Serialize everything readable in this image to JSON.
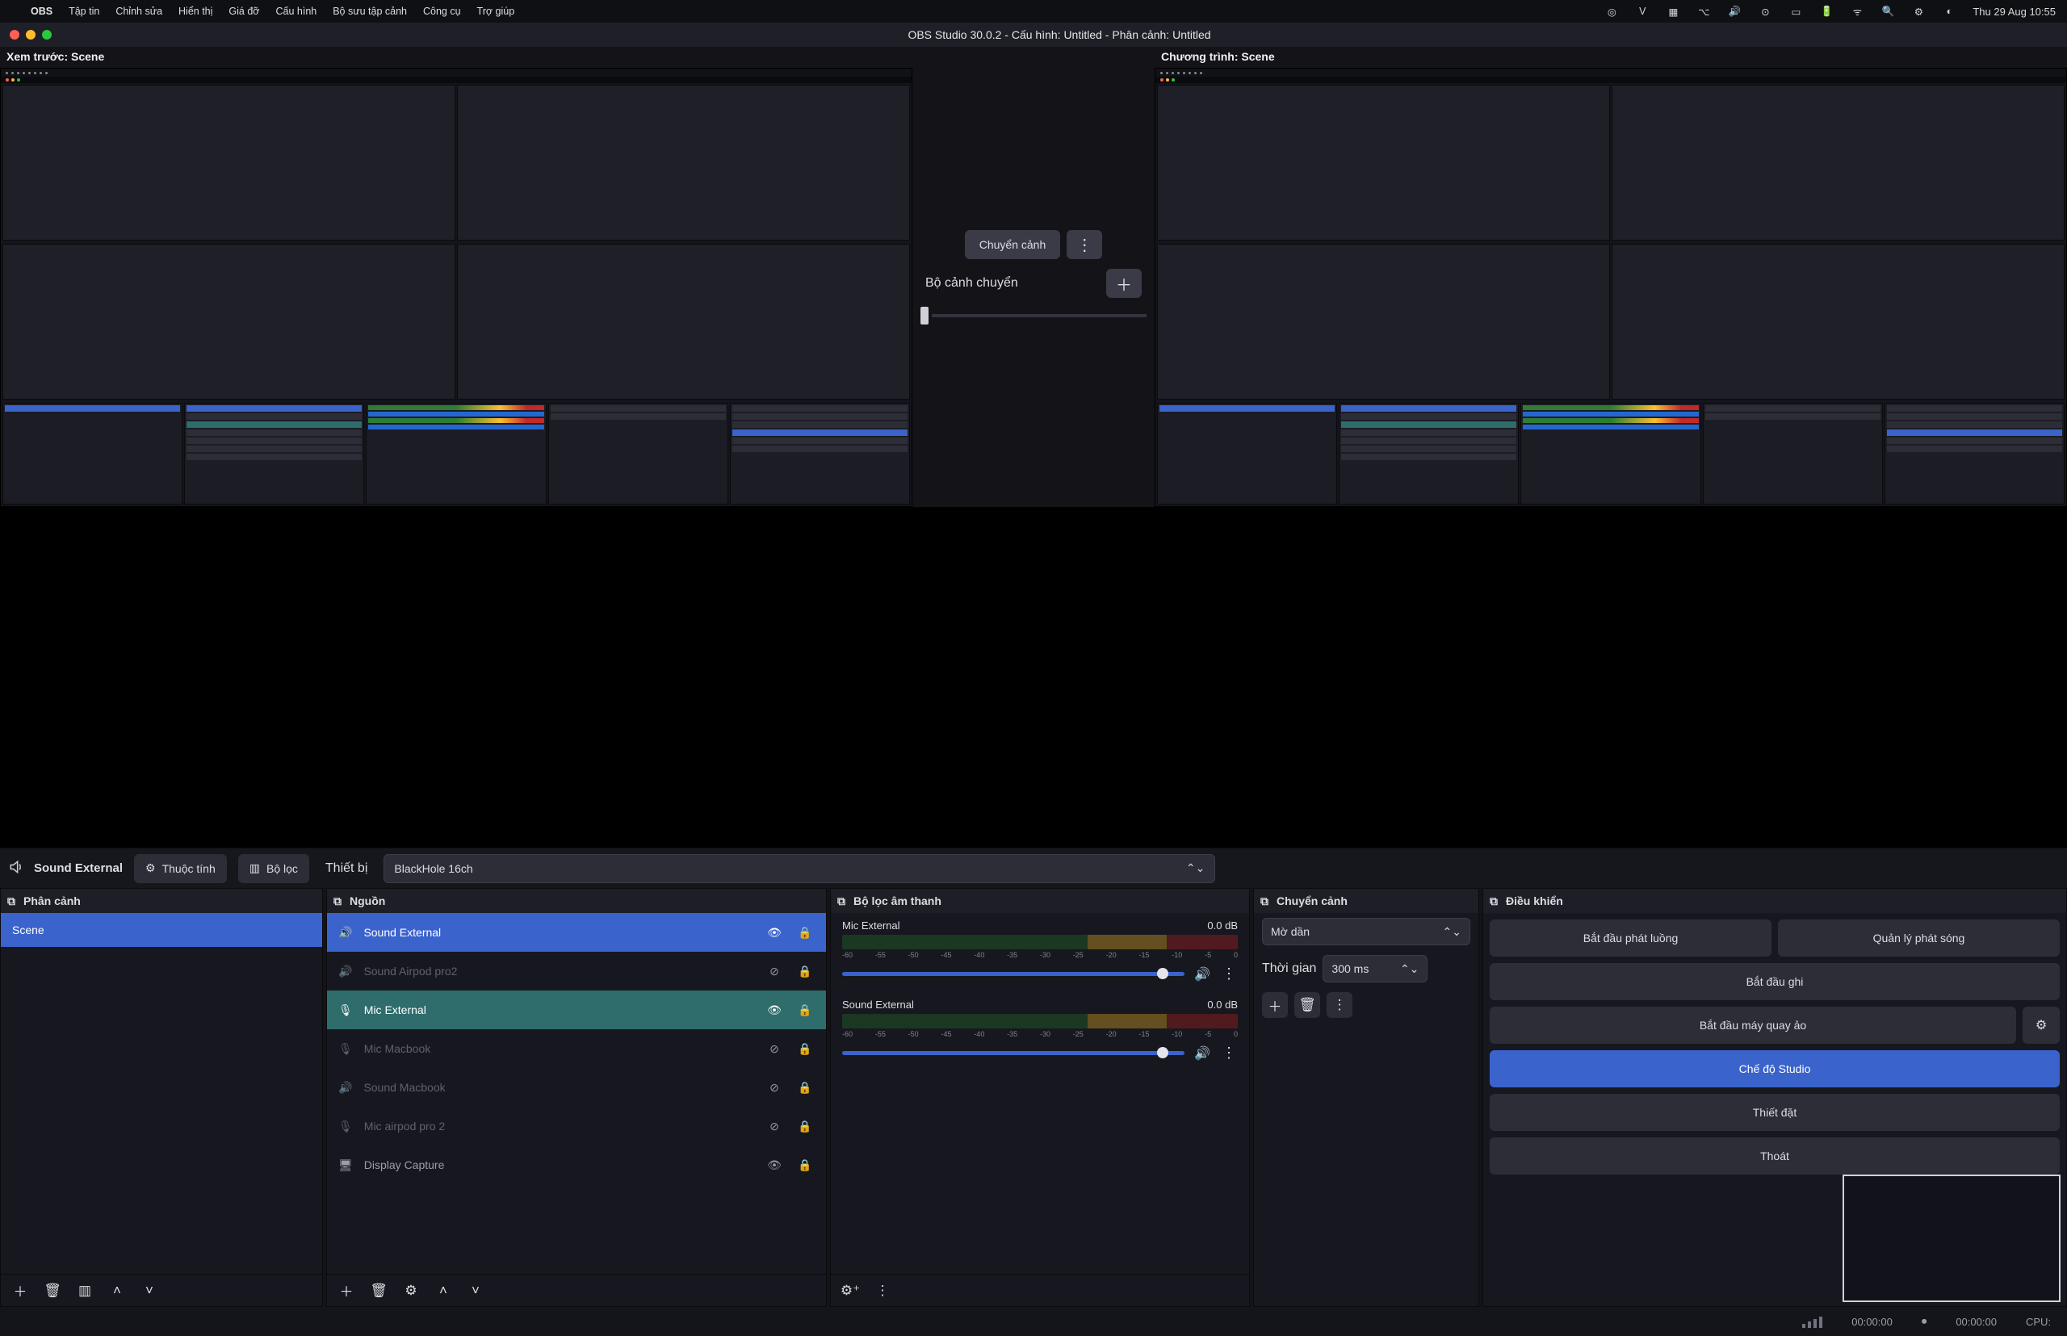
{
  "mac_menu": {
    "app": "OBS",
    "items": [
      "Tập tin",
      "Chỉnh sửa",
      "Hiển thị",
      "Giá đỡ",
      "Cấu hình",
      "Bộ sưu tập cảnh",
      "Công cụ",
      "Trợ giúp"
    ],
    "clock": "Thu 29 Aug  10:55"
  },
  "window": {
    "title": "OBS Studio 30.0.2 - Cấu hình: Untitled - Phân cảnh: Untitled"
  },
  "studio": {
    "preview_label": "Xem trước: Scene",
    "program_label": "Chương trình: Scene",
    "transition_btn": "Chuyển cảnh",
    "quick_label": "Bộ cảnh chuyển"
  },
  "context_bar": {
    "source": "Sound External",
    "properties": "Thuộc tính",
    "filters": "Bộ lọc",
    "device_label": "Thiết bị",
    "device_value": "BlackHole 16ch"
  },
  "scenes_dock": {
    "title": "Phân cảnh",
    "items": [
      "Scene"
    ]
  },
  "sources_dock": {
    "title": "Nguồn",
    "items": [
      {
        "icon": "speaker",
        "name": "Sound External",
        "visible": true,
        "style": "blue"
      },
      {
        "icon": "speaker",
        "name": "Sound Airpod pro2",
        "visible": false,
        "style": "dim"
      },
      {
        "icon": "mic",
        "name": "Mic External",
        "visible": true,
        "style": "teal"
      },
      {
        "icon": "mic",
        "name": "Mic Macbook",
        "visible": false,
        "style": "dim"
      },
      {
        "icon": "speaker",
        "name": "Sound Macbook",
        "visible": false,
        "style": "dim"
      },
      {
        "icon": "mic",
        "name": "Mic airpod pro 2",
        "visible": false,
        "style": "dim"
      },
      {
        "icon": "display",
        "name": "Display Capture",
        "visible": true,
        "style": "plain"
      }
    ]
  },
  "mixer_dock": {
    "title": "Bộ lọc âm thanh",
    "ticks": [
      "-60",
      "-55",
      "-50",
      "-45",
      "-40",
      "-35",
      "-30",
      "-25",
      "-20",
      "-15",
      "-10",
      "-5",
      "0"
    ],
    "channels": [
      {
        "name": "Mic External",
        "db": "0.0 dB"
      },
      {
        "name": "Sound External",
        "db": "0.0 dB"
      }
    ]
  },
  "transition_dock": {
    "title": "Chuyển cảnh",
    "mode": "Mờ dần",
    "duration_label": "Thời gian",
    "duration_value": "300 ms"
  },
  "controls_dock": {
    "title": "Điều khiển",
    "start_stream": "Bắt đầu phát luồng",
    "manage_stream": "Quản lý phát sóng",
    "start_record": "Bắt đầu ghi",
    "start_vcam": "Bắt đầu máy quay ảo",
    "studio_mode": "Chế độ Studio",
    "settings": "Thiết đặt",
    "exit": "Thoát"
  },
  "statusbar": {
    "time1": "00:00:00",
    "time2": "00:00:00",
    "cpu_label": "CPU:"
  }
}
